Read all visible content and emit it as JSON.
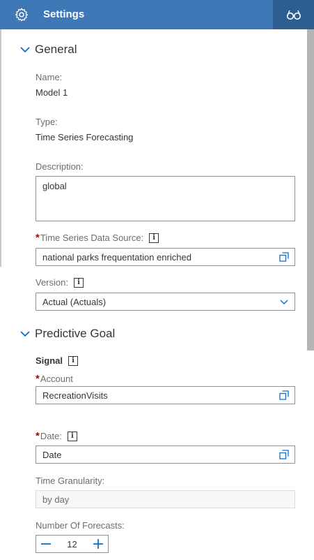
{
  "header": {
    "title": "Settings",
    "icon": "gear-icon",
    "right_icon": "glasses-icon",
    "bg_color": "#3f78b6"
  },
  "general": {
    "title": "General",
    "name_label": "Name:",
    "name_value": "Model 1",
    "type_label": "Type:",
    "type_value": "Time Series Forecasting",
    "description_label": "Description:",
    "description_value": "global",
    "data_source_label": "Time Series Data Source:",
    "data_source_value": "national parks frequentation enriched",
    "version_label": "Version:",
    "version_value": "Actual (Actuals)"
  },
  "predictive_goal": {
    "title": "Predictive Goal",
    "signal_label": "Signal",
    "account_label": "Account",
    "account_value": "RecreationVisits",
    "date_label": "Date:",
    "date_value": "Date",
    "granularity_label": "Time Granularity:",
    "granularity_value": "by day",
    "forecasts_label": "Number Of Forecasts:",
    "forecasts_value": "12"
  },
  "required_marker": "*",
  "info_glyph": "i"
}
